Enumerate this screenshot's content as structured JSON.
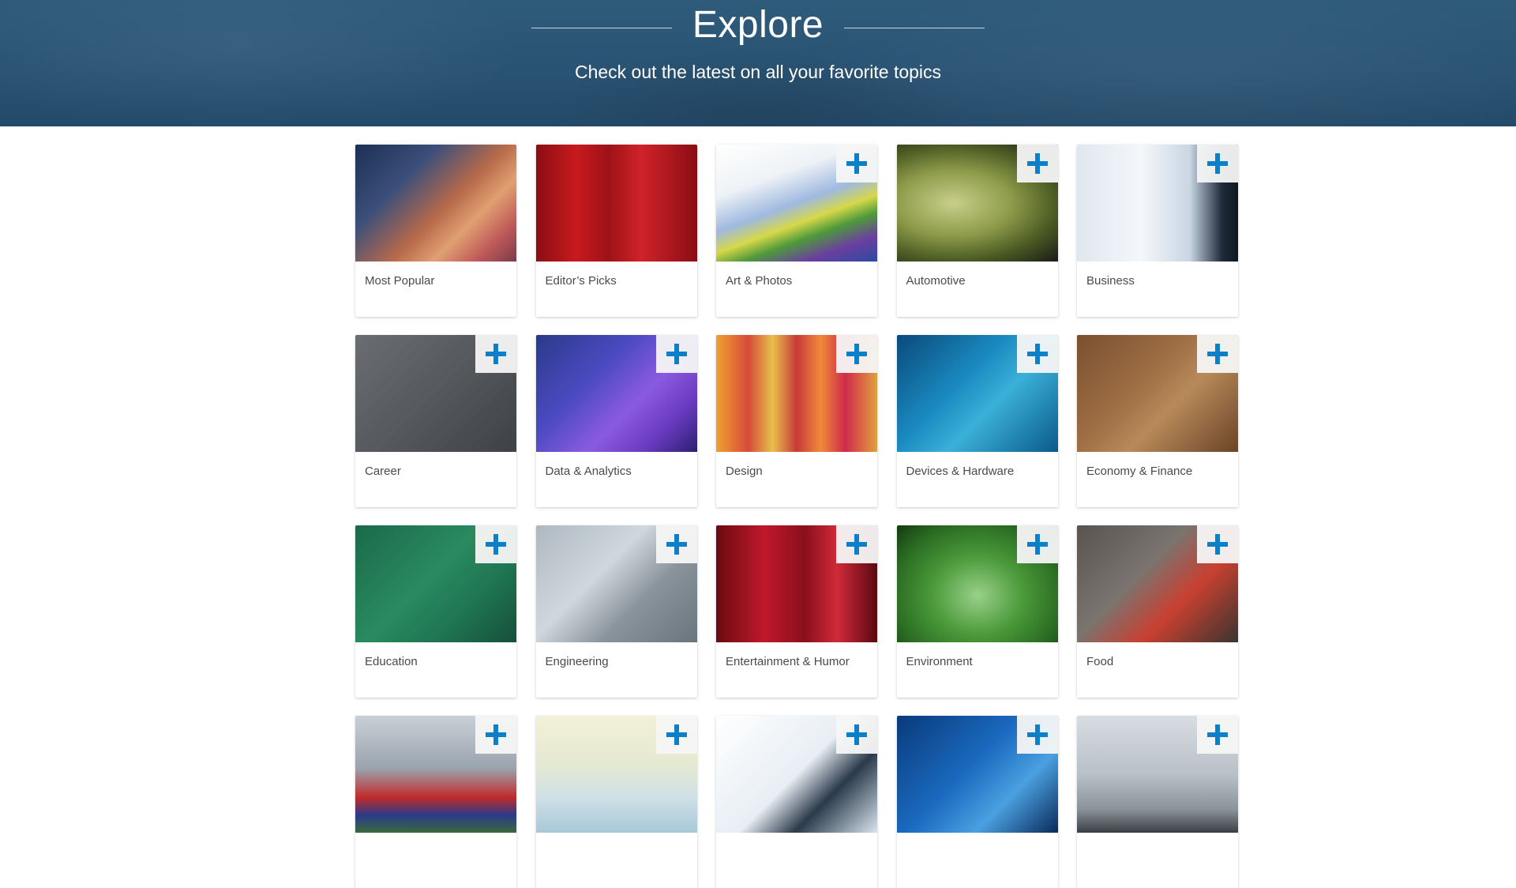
{
  "hero": {
    "title": "Explore",
    "subtitle": "Check out the latest on all your favorite topics"
  },
  "accent_color": "#0b7fc7",
  "topics": [
    {
      "label": "Most Popular",
      "add_button": false,
      "image": "presenter-at-conference",
      "gradient": "linear-gradient(135deg,#1d2f52 0%,#3b4f7a 30%,#b86a4a 55%,#e0a070 70%,#c05a5a 85%,#7a3a4a 100%)"
    },
    {
      "label": "Editor’s Picks",
      "add_button": false,
      "image": "star-trophy-red-curtain",
      "gradient": "linear-gradient(90deg,#8a0d12 0%,#c81a1e 25%,#9e1217 45%,#d0222a 65%,#8a0d12 100%)"
    },
    {
      "label": "Art & Photos",
      "add_button": true,
      "image": "paintbrush-on-palette",
      "gradient": "linear-gradient(160deg,#ffffff 0%,#eef2f6 30%,#9fb9e0 50%,#d6d84a 62%,#4f9a3a 72%,#6a3fa0 85%,#2a4aa0 100%)"
    },
    {
      "label": "Automotive",
      "add_button": true,
      "image": "speeding-car-motion-blur",
      "gradient": "radial-gradient(ellipse at 35% 50%,#c8cf8a 0%,#8d9a4a 40%,#4a5a22 70%,#1a1a1a 100%)"
    },
    {
      "label": "Business",
      "add_button": true,
      "image": "business-people-walking",
      "gradient": "linear-gradient(90deg,#dfe8ef 0%,#f4f7fa 40%,#c9d6e3 70%,#1f2a3a 90%,#0f1722 100%)"
    },
    {
      "label": "Career",
      "add_button": true,
      "image": "chalkboard-staircase",
      "gradient": "linear-gradient(135deg,#6a6e72 0%,#55595d 50%,#3e4145 100%)"
    },
    {
      "label": "Data & Analytics",
      "add_button": true,
      "image": "data-bar-charts",
      "gradient": "linear-gradient(135deg,#2a3a8a 0%,#4a4ac0 35%,#8a5ae0 60%,#6a3ac0 80%,#2a2070 100%)"
    },
    {
      "label": "Design",
      "add_button": true,
      "image": "colorful-vertical-stripes",
      "gradient": "linear-gradient(90deg,#f0a030 0%,#d84a3a 20%,#e8c04a 35%,#c83a3a 50%,#f08a3a 65%,#d02a4a 80%,#e0a040 100%)"
    },
    {
      "label": "Devices & Hardware",
      "add_button": true,
      "image": "circuit-board",
      "gradient": "linear-gradient(135deg,#0a4a7a 0%,#1a8ac0 40%,#3ab0d8 60%,#0a5a8a 100%)"
    },
    {
      "label": "Economy & Finance",
      "add_button": true,
      "image": "currency-symbols",
      "gradient": "linear-gradient(135deg,#7a5030 0%,#9e6e44 40%,#b88a5a 60%,#6a4428 100%)"
    },
    {
      "label": "Education",
      "add_button": true,
      "image": "child-with-lightbulb",
      "gradient": "linear-gradient(135deg,#1a6a4a 0%,#2a8a5e 45%,#1f7552 70%,#164f3a 100%)"
    },
    {
      "label": "Engineering",
      "add_button": true,
      "image": "caliper-and-gears",
      "gradient": "linear-gradient(135deg,#aeb8c0 0%,#d0d8de 40%,#8a949c 65%,#6a747c 100%)"
    },
    {
      "label": "Entertainment & Humor",
      "add_button": true,
      "image": "microphone-red-curtain",
      "gradient": "linear-gradient(90deg,#6a0a12 0%,#c0182a 30%,#8a0f1c 55%,#d02a3a 75%,#5a0810 100%)"
    },
    {
      "label": "Environment",
      "add_button": true,
      "image": "hands-holding-earth",
      "gradient": "radial-gradient(ellipse at 50% 60%,#9ad08a 0%,#4a9a3a 40%,#2a6a22 75%,#143a12 100%)"
    },
    {
      "label": "Food",
      "add_button": true,
      "image": "vegetables-and-spices",
      "gradient": "linear-gradient(135deg,#5a5450 0%,#7a7470 40%,#c84030 65%,#3a3430 100%)"
    },
    {
      "label": "",
      "add_button": true,
      "image": "national-flags",
      "gradient": "linear-gradient(180deg,#c8cfd6 0%,#9aa4ae 45%,#c02a2a 70%,#2a3a8a 85%,#3a6a3a 100%)"
    },
    {
      "label": "",
      "add_button": true,
      "image": "yoga-by-the-sea",
      "gradient": "linear-gradient(180deg,#f2f0d8 0%,#e6ead0 40%,#cfe0e6 70%,#a8c8d8 100%)"
    },
    {
      "label": "",
      "add_button": true,
      "image": "stethoscope",
      "gradient": "linear-gradient(135deg,#ffffff 0%,#e8eef4 50%,#2a3a4a 70%,#d8e4ee 100%)"
    },
    {
      "label": "",
      "add_button": true,
      "image": "world-network-map",
      "gradient": "linear-gradient(135deg,#0a3a7a 0%,#1a6ac0 45%,#4aa0e0 70%,#0a2a5a 100%)"
    },
    {
      "label": "",
      "add_button": true,
      "image": "person-with-umbrella-clouds",
      "gradient": "linear-gradient(180deg,#d8dde2 0%,#b8c0c8 50%,#8a929a 80%,#3a3f44 100%)"
    }
  ]
}
